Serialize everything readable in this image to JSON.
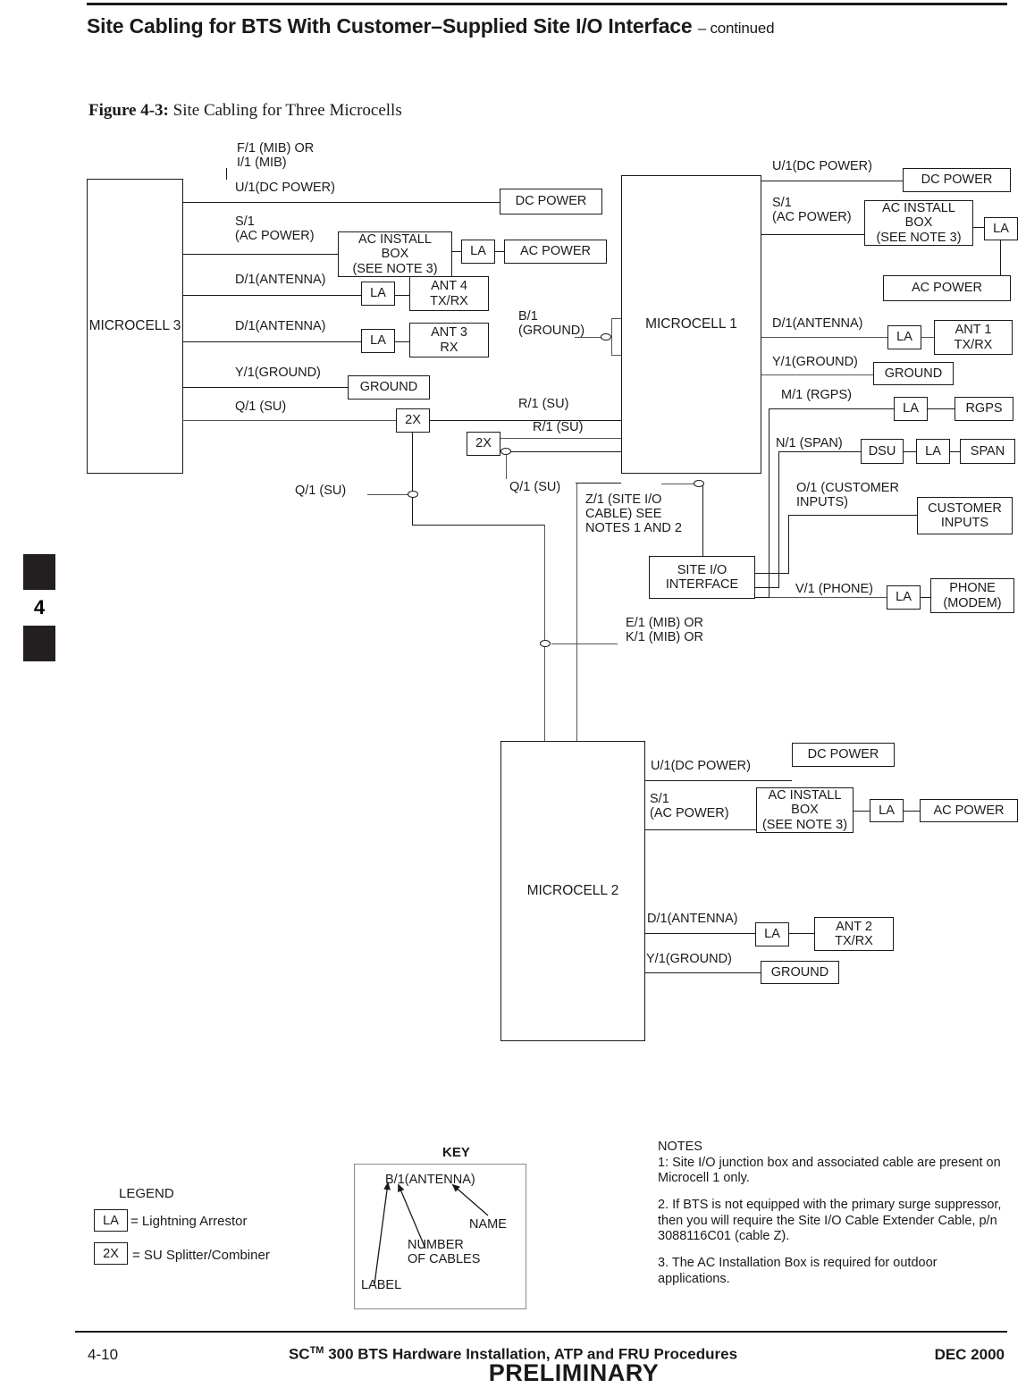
{
  "header": {
    "title": "Site Cabling for BTS With Customer–Supplied Site I/O Interface",
    "continued": "– continued"
  },
  "figure": {
    "number": "Figure 4-3:",
    "caption": "Site Cabling for Three Microcells"
  },
  "side_tab": {
    "number": "4"
  },
  "diagram": {
    "microcell3": {
      "title": "MICROCELL 3",
      "top_label": "F/1 (MIB) OR\nI/1 (MIB)",
      "ports": {
        "dc": "U/1(DC POWER)",
        "ac": "S/1\n(AC POWER)",
        "ant4": "D/1(ANTENNA)",
        "ant3": "D/1(ANTENNA)",
        "ground": "Y/1(GROUND)",
        "su": "Q/1 (SU)"
      },
      "boxes": {
        "dc_power": "DC POWER",
        "ac_install": "AC INSTALL\nBOX\n(SEE NOTE 3)",
        "la_ac": "LA",
        "ac_power": "AC POWER",
        "la_ant4": "LA",
        "ant4": "ANT 4\nTX/RX",
        "la_ant3": "LA",
        "ant3": "ANT 3\nRX",
        "ground": "GROUND",
        "splitter": "2X"
      }
    },
    "microcell1": {
      "title": "MICROCELL 1",
      "ports": {
        "dc": "U/1(DC POWER)",
        "ac": "S/1\n(AC POWER)",
        "ant1": "D/1(ANTENNA)",
        "ground": "Y/1(GROUND)",
        "rgps": "M/1 (RGPS)",
        "span": "N/1 (SPAN)",
        "customer": "O/1 (CUSTOMER\nINPUTS)",
        "phone": "V/1 (PHONE)"
      },
      "boxes": {
        "dc_power": "DC POWER",
        "ac_install": "AC INSTALL\nBOX\n(SEE NOTE 3)",
        "la_ac": "LA",
        "ac_power": "AC POWER",
        "la_ant1": "LA",
        "ant1": "ANT 1\nTX/RX",
        "ground": "GROUND",
        "la_rgps": "LA",
        "rgps": "RGPS",
        "dsu": "DSU",
        "la_span": "LA",
        "span": "SPAN",
        "customer_inputs": "CUSTOMER\nINPUTS",
        "la_phone": "LA",
        "phone": "PHONE\n(MODEM)",
        "site_io": "SITE I/O\nINTERFACE"
      }
    },
    "microcell2": {
      "title": "MICROCELL 2",
      "ports": {
        "dc": "U/1(DC POWER)",
        "ac": "S/1\n(AC POWER)",
        "ant2": "D/1(ANTENNA)",
        "ground": "Y/1(GROUND)"
      },
      "boxes": {
        "dc_power": "DC POWER",
        "ac_install": "AC INSTALL\nBOX\n(SEE NOTE 3)",
        "la_ac": "LA",
        "ac_power": "AC POWER",
        "la_ant2": "LA",
        "ant2": "ANT 2\nTX/RX",
        "ground": "GROUND"
      }
    },
    "interconnect": {
      "b1_ground": "B/1\n(GROUND)",
      "r1_su_top": "R/1 (SU)",
      "r1_su_bottom": "R/1 (SU)",
      "q1_su_left": "Q/1 (SU)",
      "q1_su_right": "Q/1 (SU)",
      "splitter_mid": "2X",
      "z1_cable": "Z/1 (SITE I/O\nCABLE) SEE\nNOTES 1 AND 2",
      "e1_k1_mib": "E/1 (MIB) OR\nK/1 (MIB) OR"
    }
  },
  "legend": {
    "title": "LEGEND",
    "items": [
      {
        "symbol": "LA",
        "text": "= Lightning  Arrestor"
      },
      {
        "symbol": "2X",
        "text": "=  SU Splitter/Combiner"
      }
    ]
  },
  "key": {
    "title": "KEY",
    "sample": "B/1(ANTENNA)",
    "name_label": "NAME",
    "number_label": "NUMBER\nOF CABLES",
    "label_label": "LABEL"
  },
  "notes": {
    "title": "NOTES",
    "items": [
      "1:  Site I/O junction box and associated cable are present on Microcell 1 only.",
      "2.  If BTS is not equipped with the primary surge suppressor, then you will require the Site I/O Cable Extender Cable, p/n 3088116C01 (cable Z).",
      "3.  The AC Installation Box is required for outdoor applications."
    ]
  },
  "footer": {
    "page": "4-10",
    "title_pre": "SC",
    "title_tm": "TM",
    "title_post": "300 BTS Hardware Installation, ATP and FRU Procedures",
    "date": "DEC 2000",
    "preliminary": "PRELIMINARY"
  }
}
